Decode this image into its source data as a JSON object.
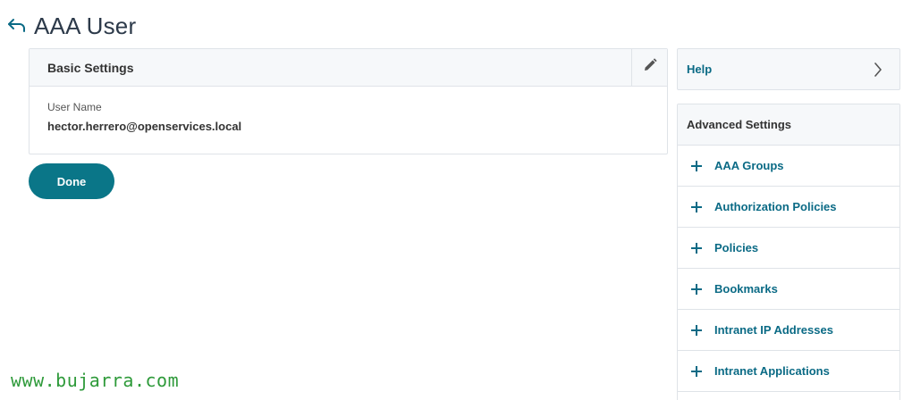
{
  "header": {
    "title": "AAA User",
    "back_icon": "back-arrow-icon"
  },
  "basic_settings": {
    "title": "Basic Settings",
    "edit_icon": "pencil-icon",
    "fields": [
      {
        "label": "User Name",
        "value": "hector.herrero@openservices.local"
      }
    ]
  },
  "actions": {
    "done_label": "Done"
  },
  "help_panel": {
    "label": "Help",
    "chevron_icon": "chevron-right-icon"
  },
  "advanced_settings": {
    "title": "Advanced Settings",
    "items": [
      {
        "label": "AAA Groups",
        "icon": "plus-icon"
      },
      {
        "label": "Authorization Policies",
        "icon": "plus-icon"
      },
      {
        "label": "Policies",
        "icon": "plus-icon"
      },
      {
        "label": "Bookmarks",
        "icon": "plus-icon"
      },
      {
        "label": "Intranet IP Addresses",
        "icon": "plus-icon"
      },
      {
        "label": "Intranet Applications",
        "icon": "plus-icon"
      }
    ]
  },
  "watermark": {
    "text": "www.bujarra.com"
  },
  "colors": {
    "accent": "#0a7688",
    "link": "#0a6a85",
    "panel_bg": "#f6f8fa",
    "border": "#dfe3e8",
    "watermark": "#2e9a3a"
  }
}
